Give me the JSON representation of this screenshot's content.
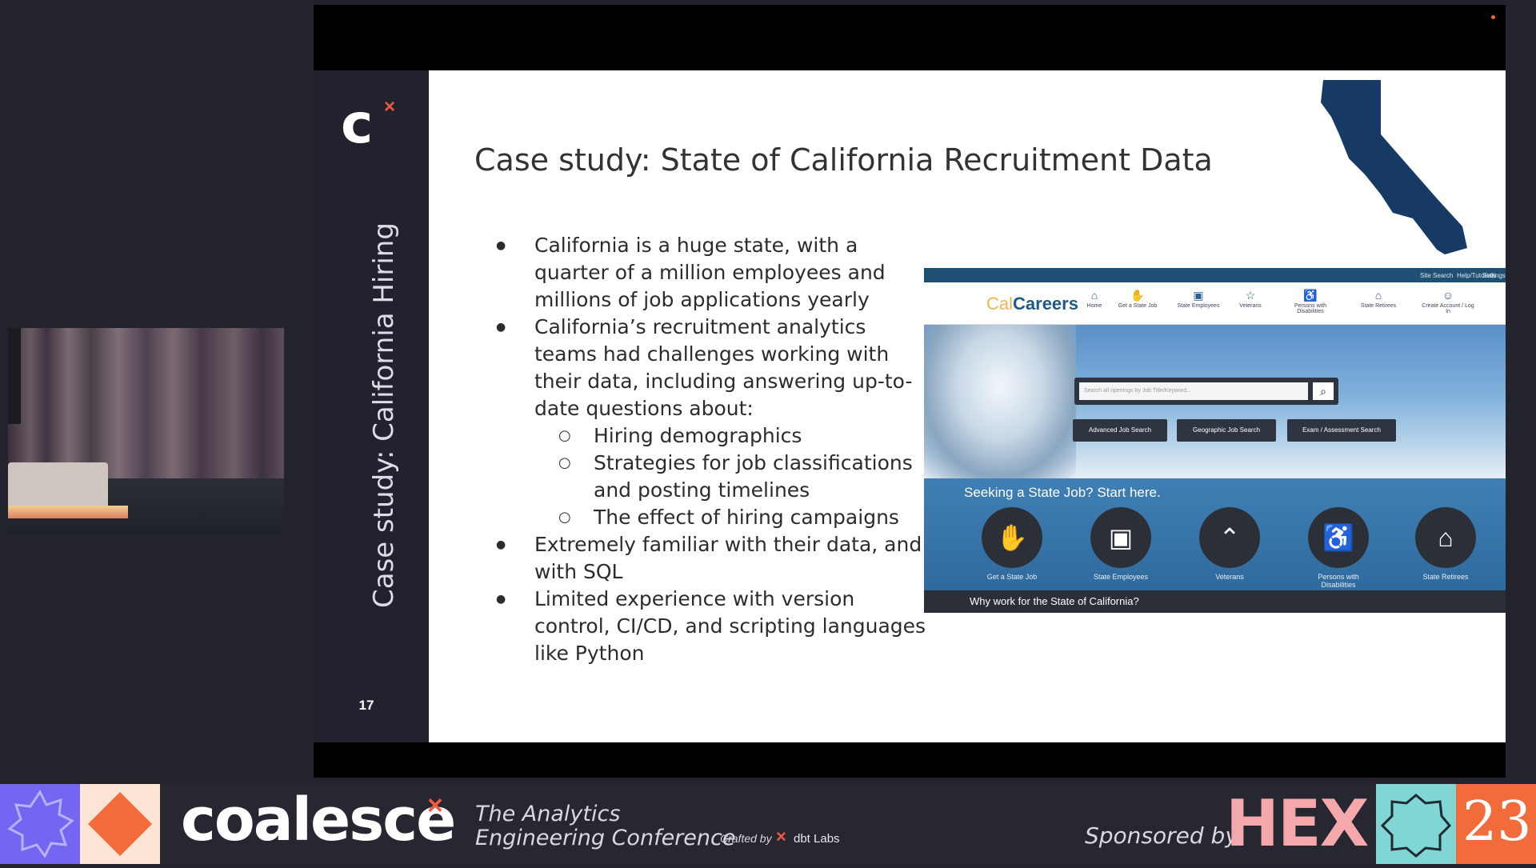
{
  "slide": {
    "side_title": "Case study: California Hiring",
    "number": "17",
    "title": "Case study: State of California Recruitment Data",
    "bullets": [
      "California is a huge state, with a quarter of a million employees and millions of job applications yearly",
      "California’s recruitment analytics teams had challenges working with their data, including answering up-to-date questions about:",
      "Extremely familiar with their data, and with SQL",
      "Limited experience with version control, CI/CD, and scripting languages like Python"
    ],
    "sub_bullets": [
      "Hiring demographics",
      "Strategies for job classifications and posting timelines",
      "The effect of hiring campaigns"
    ],
    "logo_letter": "c",
    "logo_mark": "×"
  },
  "calcareers": {
    "strip_links": [
      "Site Search",
      "Help/Tutorials",
      "Settings"
    ],
    "brand_cal": "Cal",
    "brand_careers": "Careers",
    "nav": [
      {
        "label": "Home",
        "icon": "⌂"
      },
      {
        "label": "Get a State Job",
        "icon": "✋"
      },
      {
        "label": "State Employees",
        "icon": "▣"
      },
      {
        "label": "Veterans",
        "icon": "☆"
      },
      {
        "label": "Persons with Disabilities",
        "icon": "♿"
      },
      {
        "label": "State Retirees",
        "icon": "⌂"
      },
      {
        "label": "Create Account / Log In",
        "icon": "☺"
      }
    ],
    "search_placeholder": "Search all openings by Job Title/Keyword...",
    "quick_buttons": [
      "Advanced Job Search",
      "Geographic Job Search",
      "Exam / Assessment Search"
    ],
    "seeking_text": "Seeking a State Job? Start here.",
    "circles": [
      {
        "label": "Get a State Job",
        "icon": "✋"
      },
      {
        "label": "State Employees",
        "icon": "▣"
      },
      {
        "label": "Veterans",
        "icon": "⌃"
      },
      {
        "label": "Persons with Disabilities",
        "icon": "♿"
      },
      {
        "label": "State Retirees",
        "icon": "⌂"
      }
    ],
    "why_text": "Why work for the State of California?"
  },
  "branding": {
    "coalesce": "coalesce",
    "coalesce_mark": "×",
    "tagline_line1": "The Analytics",
    "tagline_line2": "Engineering Conference",
    "crafted_by": "Crafted by",
    "dbt_mark": "×",
    "dbt_labs": "dbt Labs",
    "sponsored_by": "Sponsored by",
    "sponsor": "HEX",
    "year": "23"
  },
  "colors": {
    "accent": "#ee5b45",
    "slide_dark": "#22222e",
    "ca_map": "#163a63",
    "calcareers_blue": "#1f4f73"
  }
}
